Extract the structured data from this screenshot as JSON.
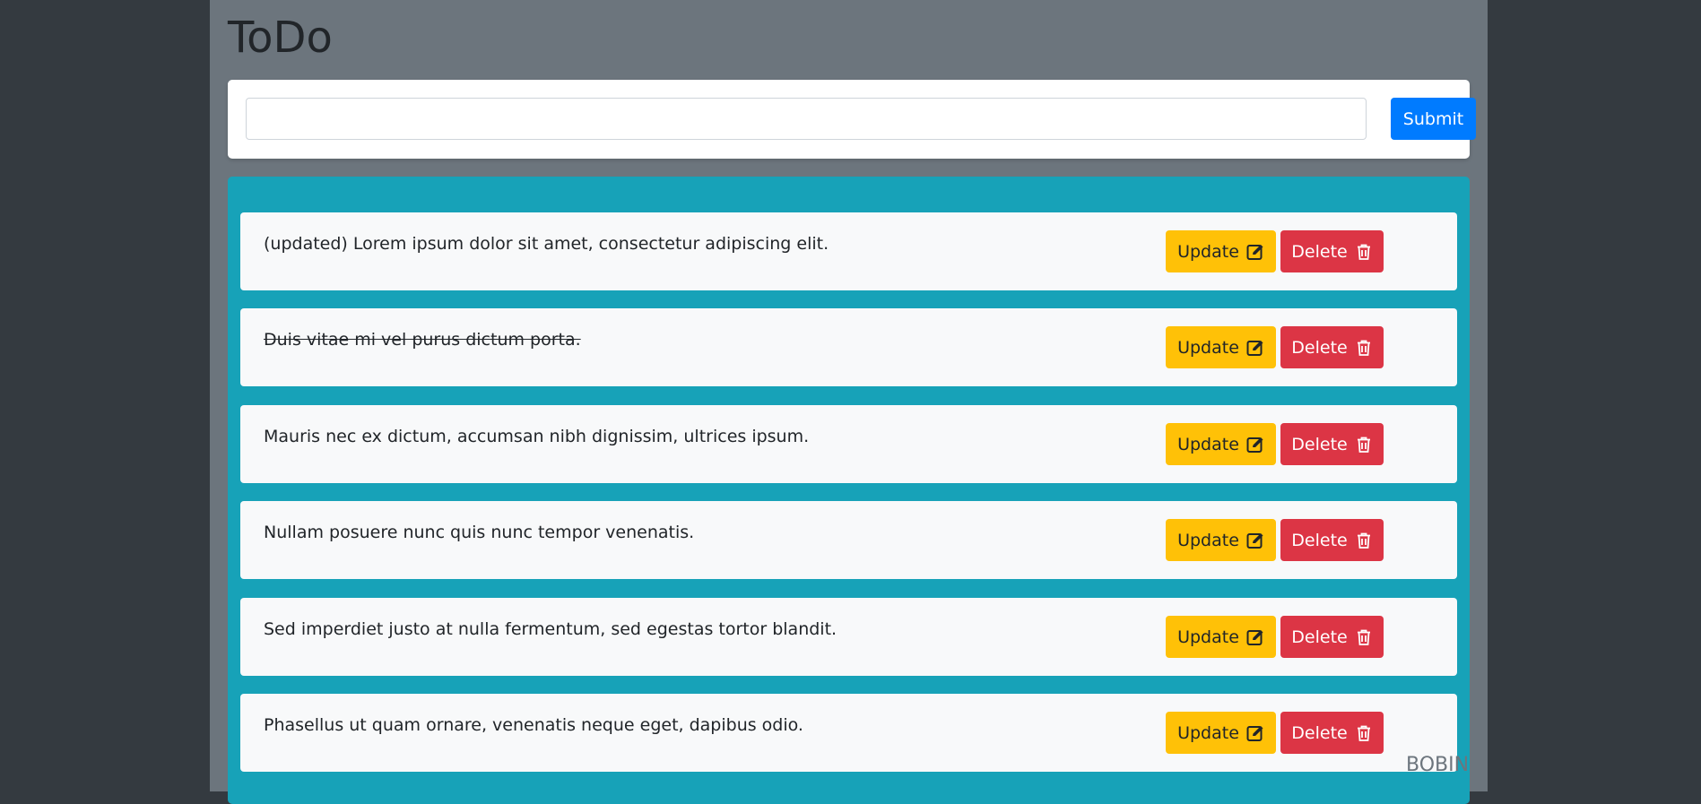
{
  "app": {
    "title": "ToDo"
  },
  "form": {
    "input_value": "",
    "input_placeholder": "",
    "submit_label": "Submit"
  },
  "todos": [
    {
      "text": "(updated) Lorem ipsum dolor sit amet, consectetur adipiscing elit.",
      "completed": false
    },
    {
      "text": "Duis vitae mi vel purus dictum porta.",
      "completed": true
    },
    {
      "text": "Mauris nec ex dictum, accumsan nibh dignissim, ultrices ipsum.",
      "completed": false
    },
    {
      "text": "Nullam posuere nunc quis nunc tempor venenatis.",
      "completed": false
    },
    {
      "text": "Sed imperdiet justo at nulla fermentum, sed egestas tortor blandit.",
      "completed": false
    },
    {
      "text": "Phasellus ut quam ornare, venenatis neque eget, dapibus odio.",
      "completed": false
    }
  ],
  "actions": {
    "update_label": "Update",
    "delete_label": "Delete",
    "update_icon": "edit-icon",
    "delete_icon": "trash-icon"
  },
  "footer": {
    "text": "BOBIN"
  },
  "colors": {
    "background": "#343a40",
    "page": "#6c757d",
    "panel": "#17a2b8",
    "primary": "#007bff",
    "warning": "#ffc107",
    "danger": "#dc3545"
  }
}
